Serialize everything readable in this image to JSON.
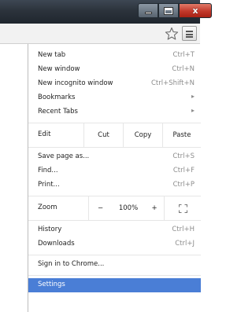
{
  "window": {
    "controls": {
      "minimize_icon": "minimize-icon",
      "maximize_icon": "maximize-icon",
      "close_icon": "close-icon",
      "close_glyph": "x"
    }
  },
  "toolbar": {
    "bookmark_icon": "star-icon",
    "menu_icon": "hamburger-menu-icon"
  },
  "menu": {
    "group1": [
      {
        "label": "New tab",
        "shortcut": "Ctrl+T"
      },
      {
        "label": "New window",
        "shortcut": "Ctrl+N"
      },
      {
        "label": "New incognito window",
        "shortcut": "Ctrl+Shift+N"
      },
      {
        "label": "Bookmarks",
        "submenu": "▸"
      },
      {
        "label": "Recent Tabs",
        "submenu": "▸"
      }
    ],
    "edit_row": {
      "label": "Edit",
      "cut": "Cut",
      "copy": "Copy",
      "paste": "Paste"
    },
    "group2": [
      {
        "label": "Save page as...",
        "shortcut": "Ctrl+S"
      },
      {
        "label": "Find...",
        "shortcut": "Ctrl+F"
      },
      {
        "label": "Print...",
        "shortcut": "Ctrl+P"
      }
    ],
    "zoom_row": {
      "label": "Zoom",
      "minus": "−",
      "value": "100%",
      "plus": "+",
      "fullscreen_icon": "fullscreen-icon"
    },
    "group3": [
      {
        "label": "History",
        "shortcut": "Ctrl+H"
      },
      {
        "label": "Downloads",
        "shortcut": "Ctrl+J"
      }
    ],
    "signin": {
      "label": "Sign in to Chrome..."
    },
    "settings": {
      "label": "Settings"
    }
  },
  "colors": {
    "selected_bg": "#4a7ed6",
    "shortcut_text": "#8c8c8c"
  }
}
